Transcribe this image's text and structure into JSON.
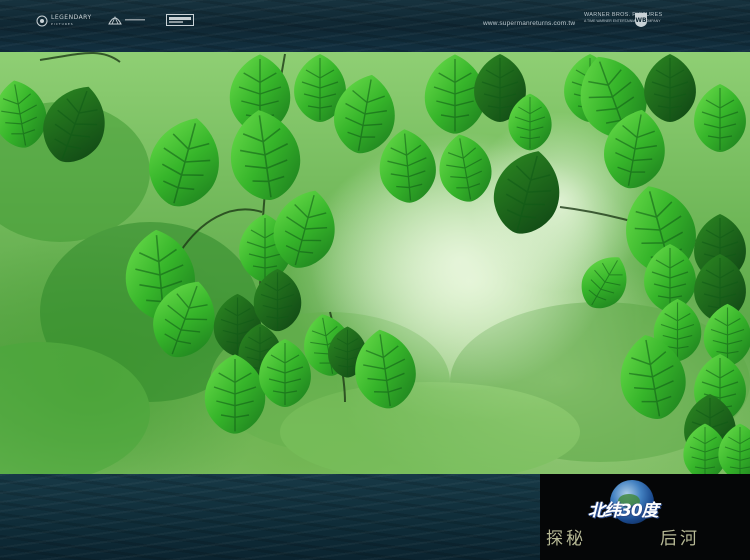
{
  "header": {
    "logos": [
      {
        "name": "legendary-logo",
        "text": "LEGENDARY",
        "subtext": "PICTURES"
      },
      {
        "name": "bad-hat-harry-logo",
        "text": "",
        "subtext": ""
      },
      {
        "name": "peters-logo",
        "text": "",
        "subtext": ""
      }
    ],
    "site_url": "www.supermanreturns.com.tw",
    "studio_name": "WARNER BROS. PICTURES",
    "studio_sub": "A TIME WARNER ENTERTAINMENT COMPANY"
  },
  "badge": {
    "title": "北纬30度",
    "left_text": "探秘",
    "right_text": "后河"
  },
  "colors": {
    "frame": "#0e2a36",
    "leaf_light": "#4fc23a",
    "leaf_dark": "#1a6a1c",
    "badge_bg": "#050607",
    "badge_text": "#b7b995"
  }
}
